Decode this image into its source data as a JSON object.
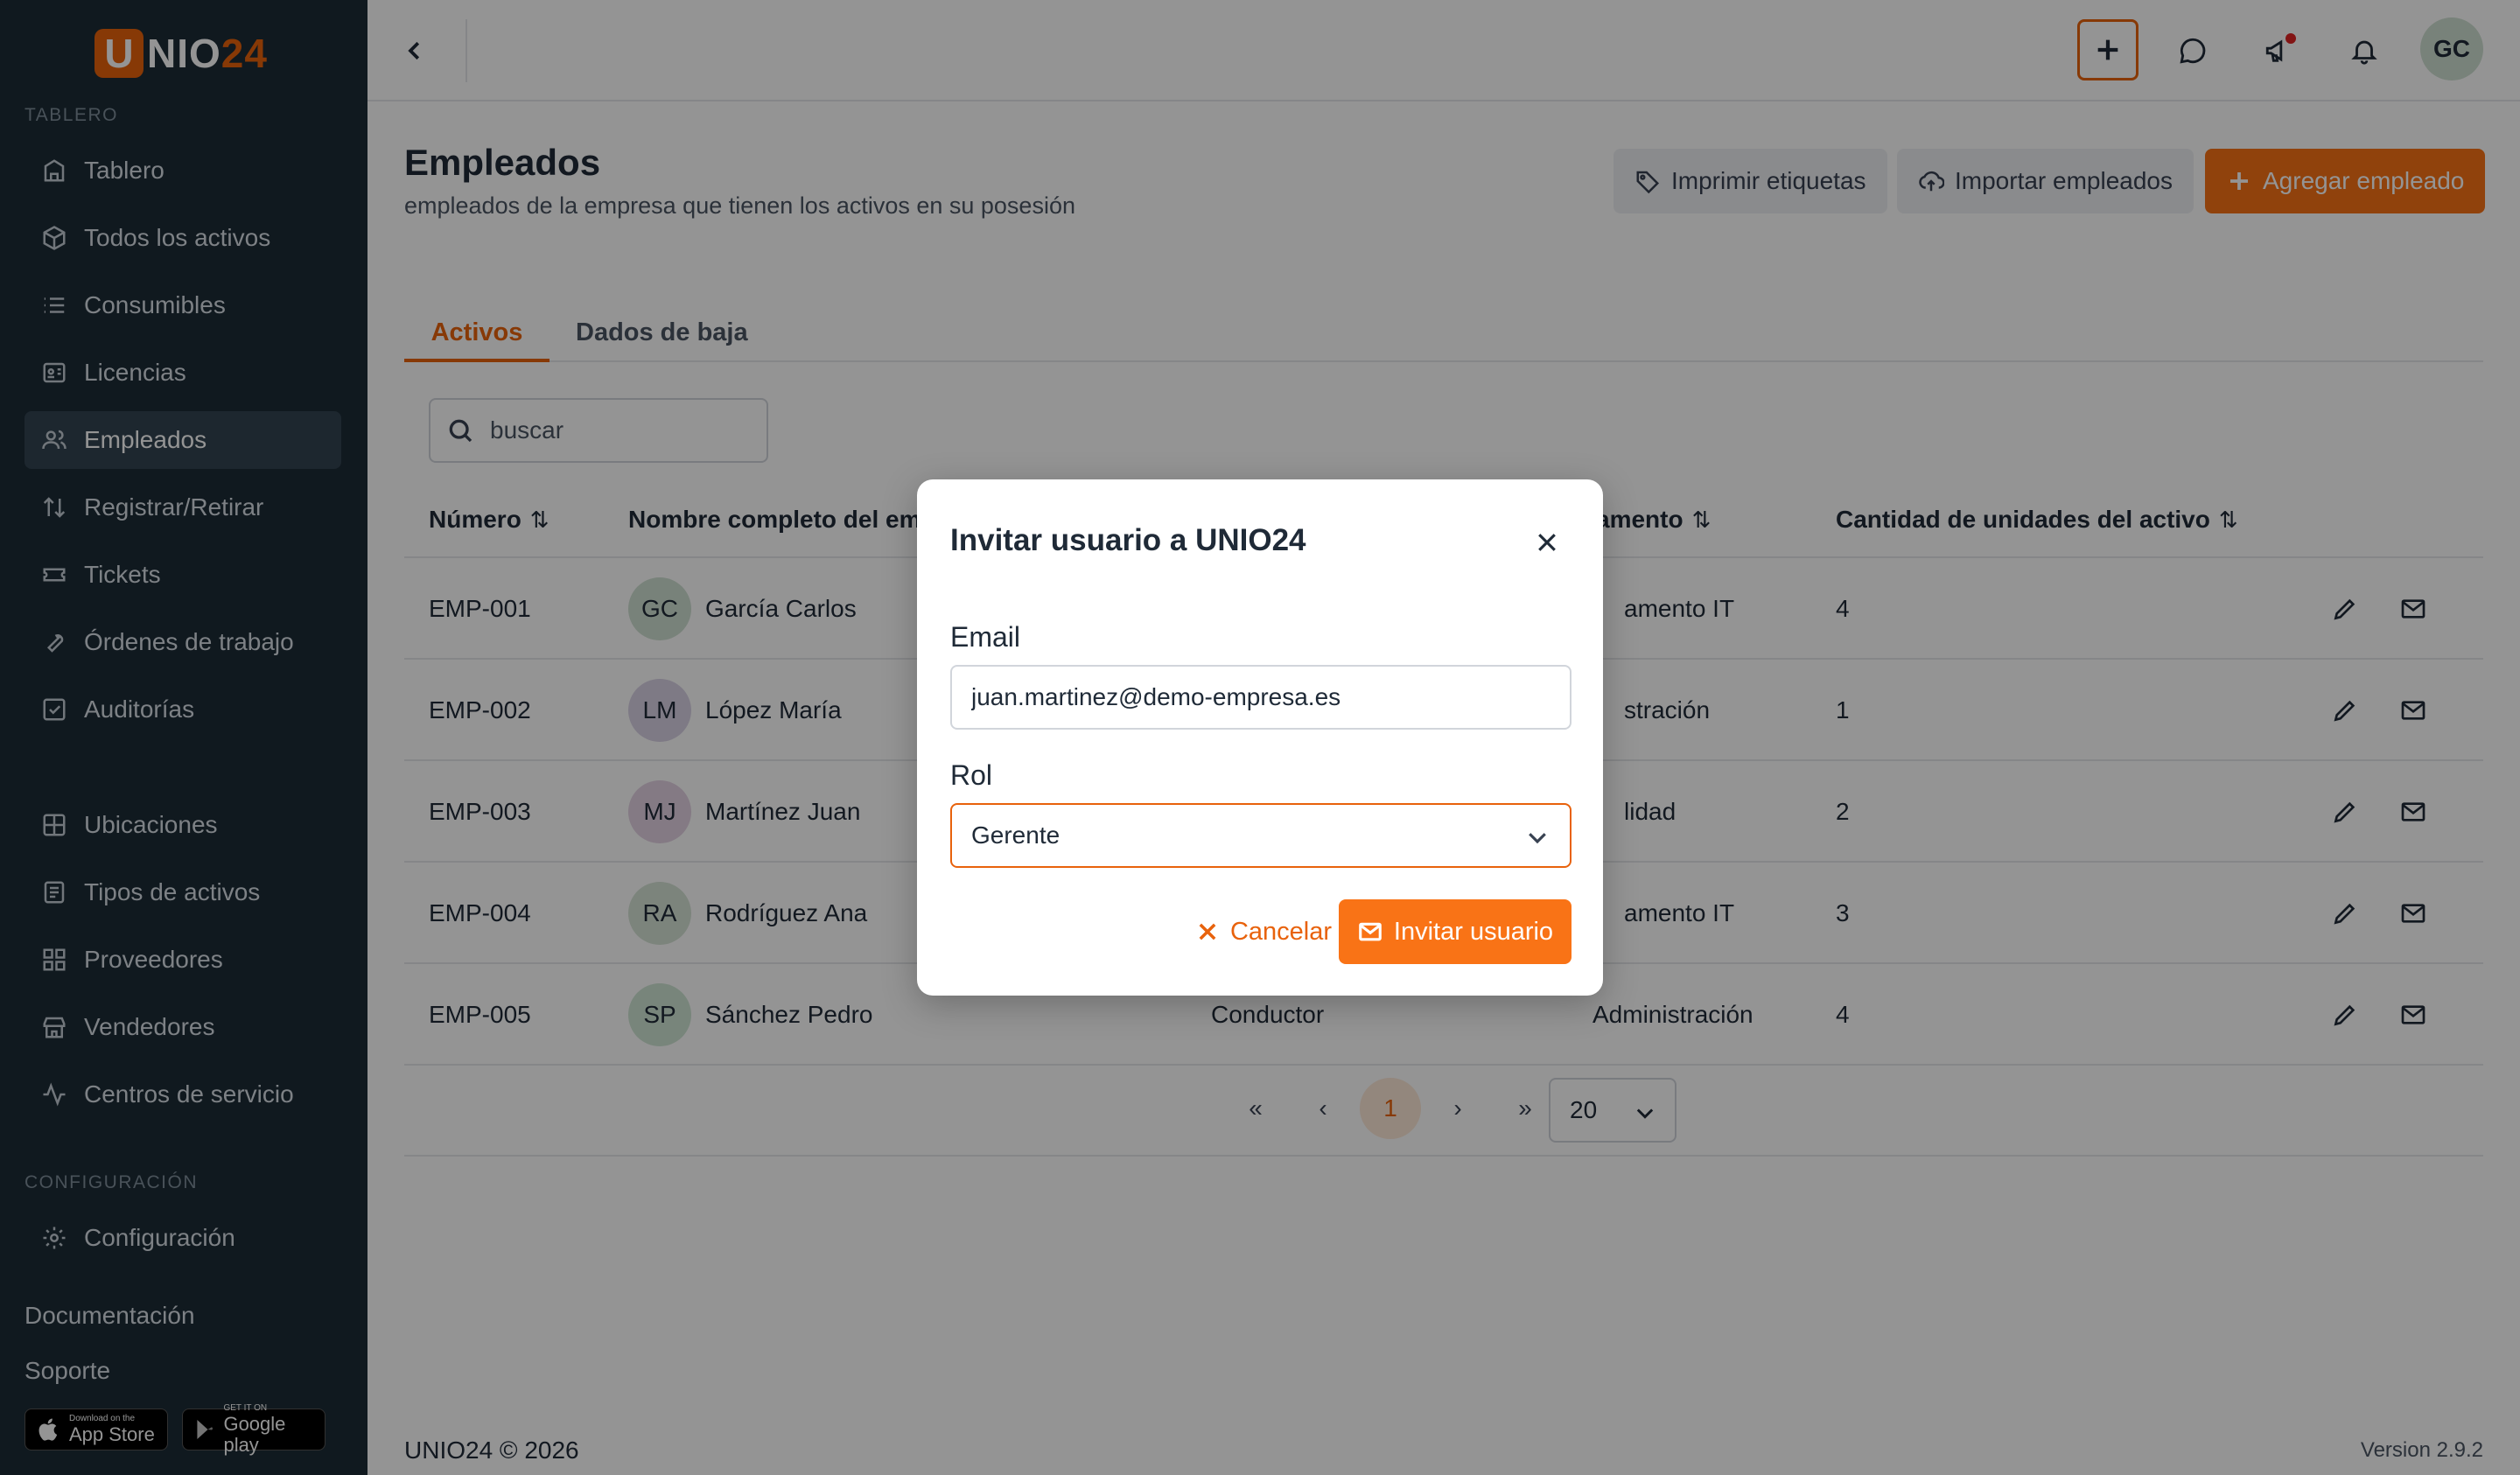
{
  "brand": {
    "logo_letter": "U",
    "logo_rest": "NIO",
    "logo_num": "24"
  },
  "sidebar": {
    "section_dashboard": "TABLERO",
    "items": [
      {
        "label": "Tablero",
        "icon": "building-icon"
      },
      {
        "label": "Todos los activos",
        "icon": "cube-icon"
      },
      {
        "label": "Consumibles",
        "icon": "list-icon"
      },
      {
        "label": "Licencias",
        "icon": "id-card-icon"
      },
      {
        "label": "Empleados",
        "icon": "users-icon",
        "active": true
      },
      {
        "label": "Registrar/Retirar",
        "icon": "arrows-updown-icon"
      },
      {
        "label": "Tickets",
        "icon": "ticket-icon"
      },
      {
        "label": "Órdenes de trabajo",
        "icon": "wrench-icon"
      },
      {
        "label": "Auditorías",
        "icon": "checkbox-icon"
      }
    ],
    "items2": [
      {
        "label": "Ubicaciones",
        "icon": "grid-icon"
      },
      {
        "label": "Tipos de activos",
        "icon": "document-icon"
      },
      {
        "label": "Proveedores",
        "icon": "apps-icon"
      },
      {
        "label": "Vendedores",
        "icon": "store-icon"
      },
      {
        "label": "Centros de servicio",
        "icon": "activity-icon"
      }
    ],
    "section_config": "CONFIGURACIÓN",
    "config_label": "Configuración",
    "docs_label": "Documentación",
    "support_label": "Soporte",
    "appstore_small": "Download on the",
    "appstore_big": "App Store",
    "googleplay_small": "GET IT ON",
    "googleplay_big": "Google play"
  },
  "topbar": {
    "avatar": "GC"
  },
  "page": {
    "title": "Empleados",
    "subtitle": "empleados de la empresa que tienen los activos en su posesión",
    "print_labels": "Imprimir etiquetas",
    "import_employees": "Importar empleados",
    "add_employee": "Agregar empleado"
  },
  "tabs": [
    {
      "label": "Activos",
      "active": true
    },
    {
      "label": "Dados de baja",
      "active": false
    }
  ],
  "search": {
    "placeholder": "buscar"
  },
  "table": {
    "headers": {
      "number": "Número",
      "name": "Nombre completo del em",
      "department": "amento",
      "units": "Cantidad de unidades del activo",
      "sort": "⇅"
    },
    "rows": [
      {
        "id": "EMP-001",
        "initials": "GC",
        "name": "García Carlos",
        "position": "",
        "department": "amento IT",
        "units": "4",
        "avatar_color": "#cfe0d2"
      },
      {
        "id": "EMP-002",
        "initials": "LM",
        "name": "López María",
        "position": "",
        "department": "stración",
        "units": "1",
        "avatar_color": "#d9d2e6"
      },
      {
        "id": "EMP-003",
        "initials": "MJ",
        "name": "Martínez Juan",
        "position": "",
        "department": "lidad",
        "units": "2",
        "avatar_color": "#e4d2e4"
      },
      {
        "id": "EMP-004",
        "initials": "RA",
        "name": "Rodríguez Ana",
        "position": "",
        "department": "amento IT",
        "units": "3",
        "avatar_color": "#d6e3d6"
      },
      {
        "id": "EMP-005",
        "initials": "SP",
        "name": "Sánchez Pedro",
        "position": "Conductor",
        "department": "Administración",
        "units": "4",
        "avatar_color": "#cfe6d4"
      }
    ]
  },
  "pagination": {
    "first": "«",
    "prev": "‹",
    "current": "1",
    "next": "›",
    "last": "»",
    "page_size": "20"
  },
  "footer": {
    "copyright": "UNIO24 © 2026",
    "version": "Version 2.9.2"
  },
  "modal": {
    "title": "Invitar usuario a UNIO24",
    "email_label": "Email",
    "email_value": "juan.martinez@demo-empresa.es",
    "role_label": "Rol",
    "role_value": "Gerente",
    "cancel": "Cancelar",
    "invite": "Invitar usuario"
  },
  "colors": {
    "accent": "#f97316",
    "sidebar_bg": "#1c2b36",
    "active_item": "#334451"
  }
}
